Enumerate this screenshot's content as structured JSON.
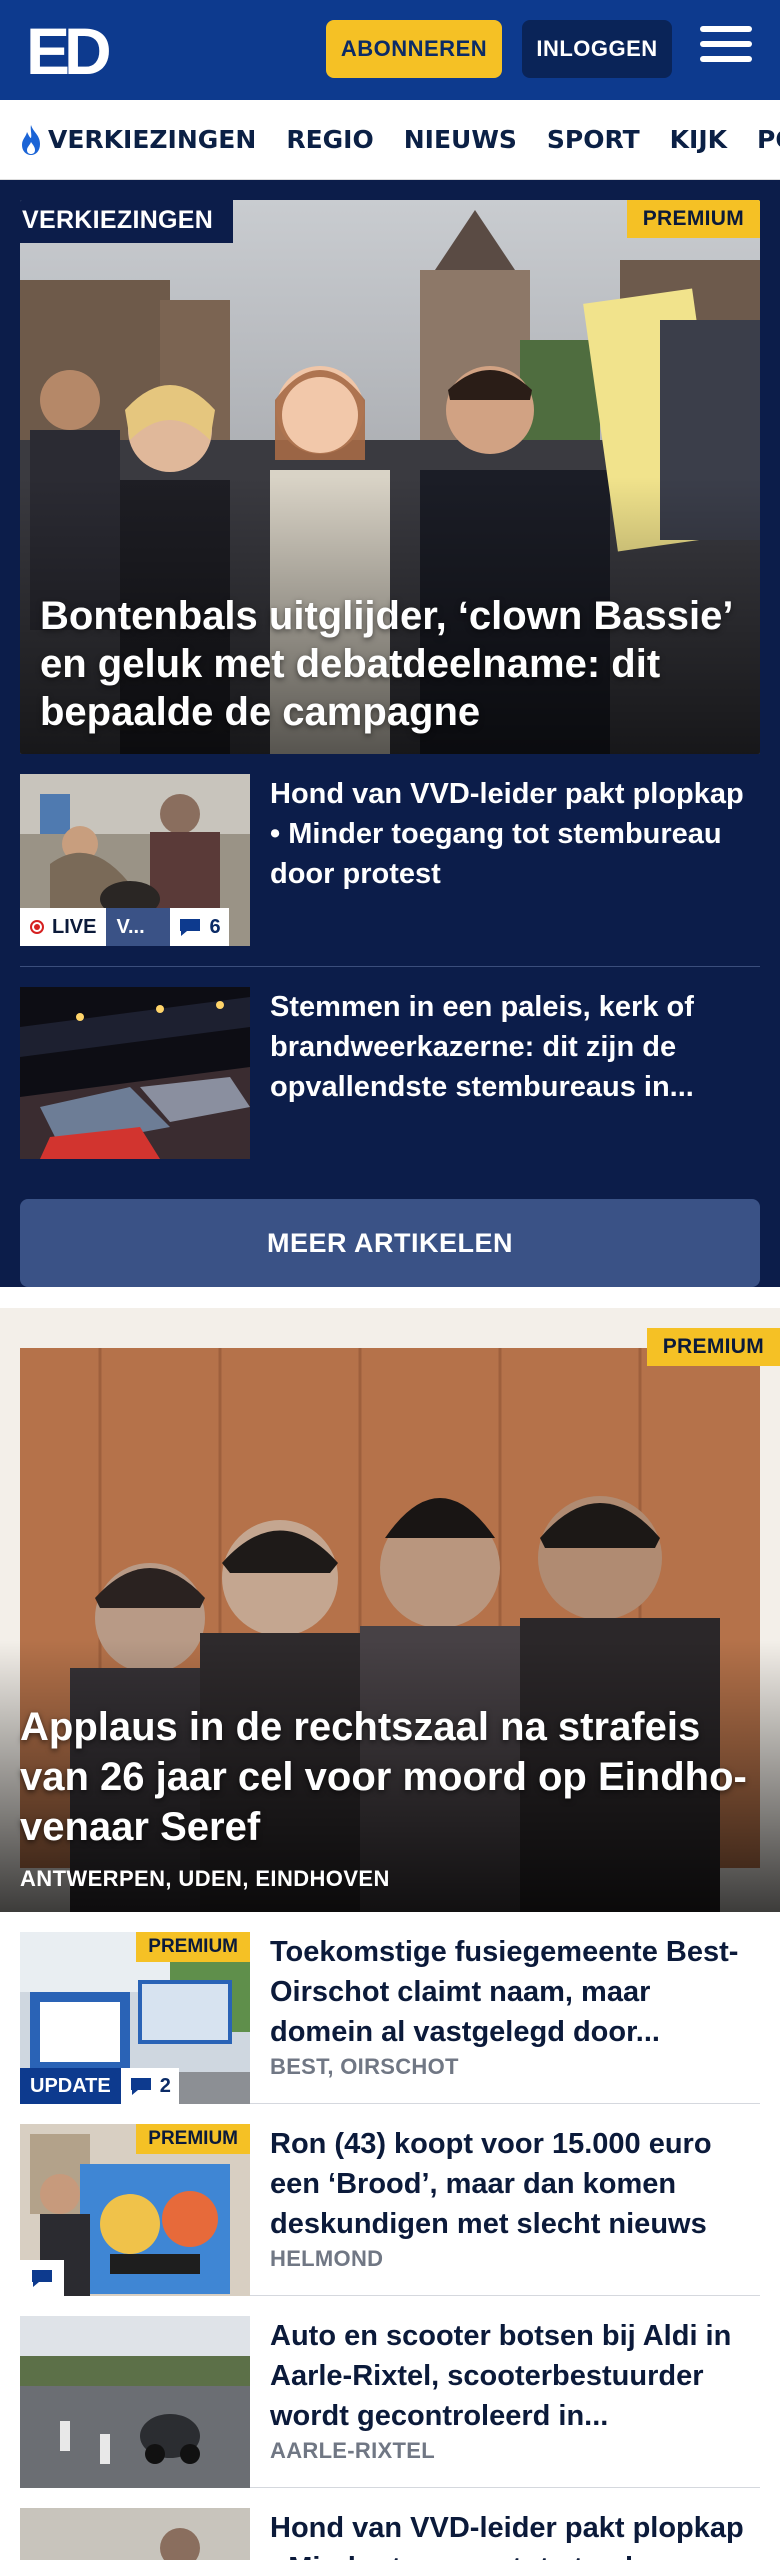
{
  "header": {
    "logo_text": "ED",
    "subscribe_label": "ABONNEREN",
    "login_label": "INLOGGEN"
  },
  "nav": {
    "items": [
      "VERKIEZINGEN",
      "REGIO",
      "NIEUWS",
      "SPORT",
      "KIJK",
      "PODCASTS"
    ]
  },
  "elections": {
    "section_tag": "VERKIEZINGEN",
    "hero": {
      "premium": "PREMIUM",
      "title": "Bontenbals uitglijder, ‘clown Bassie’ en geluk met debatdeelna­me: dit bepaalde de campagne"
    },
    "articles": [
      {
        "title": "Hond van VVD-leider pakt plopkap • Minder toegang tot stembureau door protest",
        "live": "LIVE",
        "tag": "V...",
        "comments": "6"
      },
      {
        "title": "Stemmen in een paleis, kerk of brandweerkazerne: dit zijn de opvallendste stembureaus in..."
      }
    ],
    "more_label": "MEER ARTIKELEN"
  },
  "court": {
    "premium": "PREMIUM",
    "title": "Applaus in de rechtszaal na strafeis van 26 jaar cel voor moord op Eindho­venaar Seref",
    "location": "ANTWERPEN, UDEN, EINDHOVEN"
  },
  "list": [
    {
      "title": "Toekomstige fusiegemeente Best-Oirschot claimt naam, maar domein al vastgelegd door...",
      "location": "BEST, OIRSCHOT",
      "premium": "PREMIUM",
      "badge": "UPDATE",
      "comments": "2"
    },
    {
      "title": "Ron (43) koopt voor 15.000 euro een ‘Brood’, maar dan komen deskundigen met slecht nieuws",
      "location": "HELMOND",
      "premium": "PREMIUM"
    },
    {
      "title": "Auto en scooter botsen bij Aldi in Aarle-Rixtel, scooterbestuurder wordt gecontroleerd in...",
      "location": "AARLE-RIXTEL"
    },
    {
      "title": "Hond van VVD-leider pakt plopkap • Minder toegang tot stembureau door protest",
      "location": ""
    }
  ],
  "colors": {
    "brand_blue": "#0d3a8e",
    "navy": "#0c1d4a",
    "premium_yellow": "#f5c125",
    "button_slate": "#3a5286"
  }
}
